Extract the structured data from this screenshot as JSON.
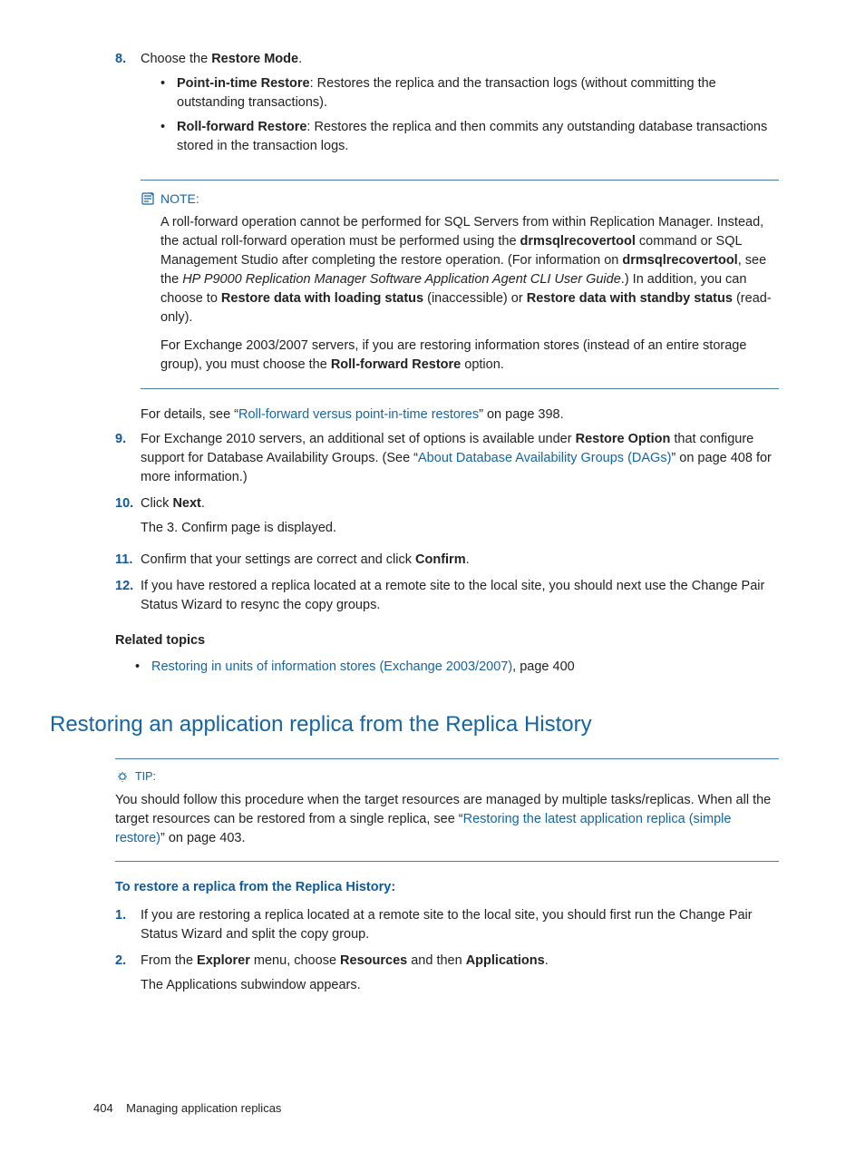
{
  "step8": {
    "num": "8.",
    "text_a": "Choose the ",
    "text_b": "Restore Mode",
    "text_c": ".",
    "bullets": [
      {
        "bold": "Point-in-time Restore",
        "rest": ": Restores the replica and the transaction logs (without committing the outstanding transactions)."
      },
      {
        "bold": "Roll-forward Restore",
        "rest": ": Restores the replica and then commits any outstanding database transactions stored in the transaction logs."
      }
    ]
  },
  "note": {
    "label": "NOTE:",
    "p1_a": "A roll-forward operation cannot be performed for SQL Servers from within Replication Manager. Instead, the actual roll-forward operation must be performed using the ",
    "p1_b": "drmsqlrecovertool",
    "p1_c": " command or SQL Management Studio after completing the restore operation. (For information on ",
    "p1_d": "drmsqlrecovertool",
    "p1_e": ", see the ",
    "p1_f": "HP P9000 Replication Manager Software Application Agent CLI User Guide",
    "p1_g": ".) In addition, you can choose to ",
    "p1_h": "Restore data with loading status",
    "p1_i": " (inaccessible) or ",
    "p1_j": "Restore data with standby status",
    "p1_k": " (read-only).",
    "p2_a": "For Exchange 2003/2007 servers, if you are restoring information stores (instead of an entire storage group), you must choose the ",
    "p2_b": "Roll-forward Restore",
    "p2_c": " option."
  },
  "after_note": {
    "a": "For details, see “",
    "link": "Roll-forward versus point-in-time restores",
    "b": "” on page 398."
  },
  "step9": {
    "num": "9.",
    "a": "For Exchange 2010 servers, an additional set of options is available under ",
    "b": "Restore Option",
    "c": " that configure support for Database Availability Groups. (See “",
    "link": "About Database Availability Groups (DAGs)",
    "d": "” on page 408 for more information.)"
  },
  "step10": {
    "num": "10.",
    "a": "Click ",
    "b": "Next",
    "c": ".",
    "sub": "The 3. Confirm page is displayed."
  },
  "step11": {
    "num": "11.",
    "a": "Confirm that your settings are correct and click ",
    "b": "Confirm",
    "c": "."
  },
  "step12": {
    "num": "12.",
    "text": "If you have restored a replica located at a remote site to the local site, you should next use the Change Pair Status Wizard to resync the copy groups."
  },
  "related": {
    "heading": "Related topics",
    "item_link": "Restoring in units of information stores (Exchange 2003/2007)",
    "item_suffix": ", page 400"
  },
  "section_title": "Restoring an application replica from the Replica History",
  "tip": {
    "label": "TIP:",
    "a": "You should follow this procedure when the target resources are managed by multiple tasks/replicas. When all the target resources can be restored from a single replica, see “",
    "link": "Restoring the latest application replica (simple restore)",
    "b": "” on page 403."
  },
  "proc": {
    "heading": "To restore a replica from the Replica History:",
    "s1": {
      "num": "1.",
      "text": "If you are restoring a replica located at a remote site to the local site, you should first run the Change Pair Status Wizard and split the copy group."
    },
    "s2": {
      "num": "2.",
      "a": "From the ",
      "b": "Explorer",
      "c": " menu, choose ",
      "d": "Resources",
      "e": " and then ",
      "f": "Applications",
      "g": ".",
      "sub": "The Applications subwindow appears."
    }
  },
  "footer": {
    "page": "404",
    "title": "Managing application replicas"
  }
}
